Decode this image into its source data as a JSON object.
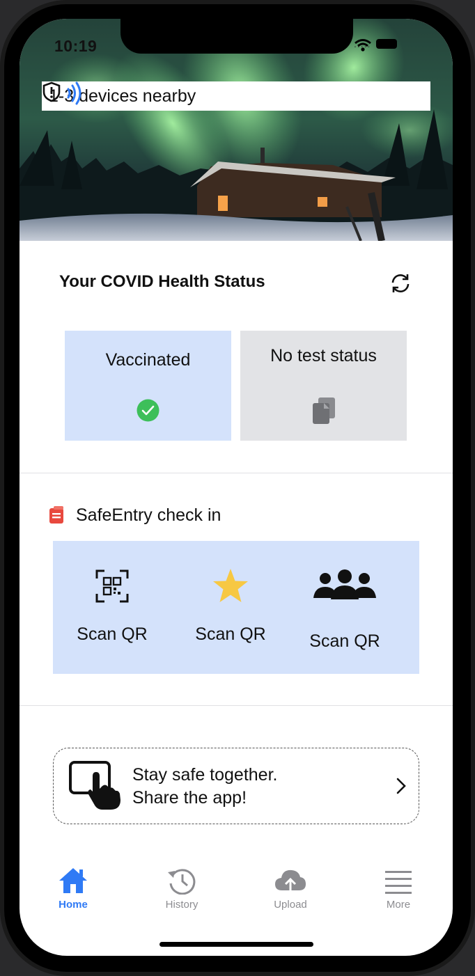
{
  "status_bar": {
    "time": "10:19",
    "signal_dots": "....."
  },
  "banner": {
    "text": "1-3 devices nearby"
  },
  "health": {
    "title": "Your COVID Health Status",
    "cards": [
      {
        "label": "Vaccinated",
        "icon": "check-circle-icon",
        "color": "#d4e2fb"
      },
      {
        "label": "No test status",
        "icon": "documents-icon",
        "color": "#e2e3e6"
      }
    ]
  },
  "safeentry": {
    "title": "SafeEntry check in",
    "actions": [
      {
        "label": "Scan QR",
        "icon": "qr-code-icon"
      },
      {
        "label": "Scan QR",
        "icon": "star-icon"
      },
      {
        "label": "Scan QR",
        "icon": "group-icon"
      }
    ]
  },
  "share": {
    "line1": "Stay safe together.",
    "line2": "Share the app!"
  },
  "tabs": [
    {
      "label": "Home",
      "icon": "home-icon",
      "active": true
    },
    {
      "label": "History",
      "icon": "history-icon"
    },
    {
      "label": "Upload",
      "icon": "cloud-upload-icon"
    },
    {
      "label": "More",
      "icon": "menu-icon"
    }
  ],
  "colors": {
    "accent": "#2f7af5",
    "check": "#3dbf5a",
    "star": "#f7c843",
    "safeentry": "#e8493e"
  }
}
